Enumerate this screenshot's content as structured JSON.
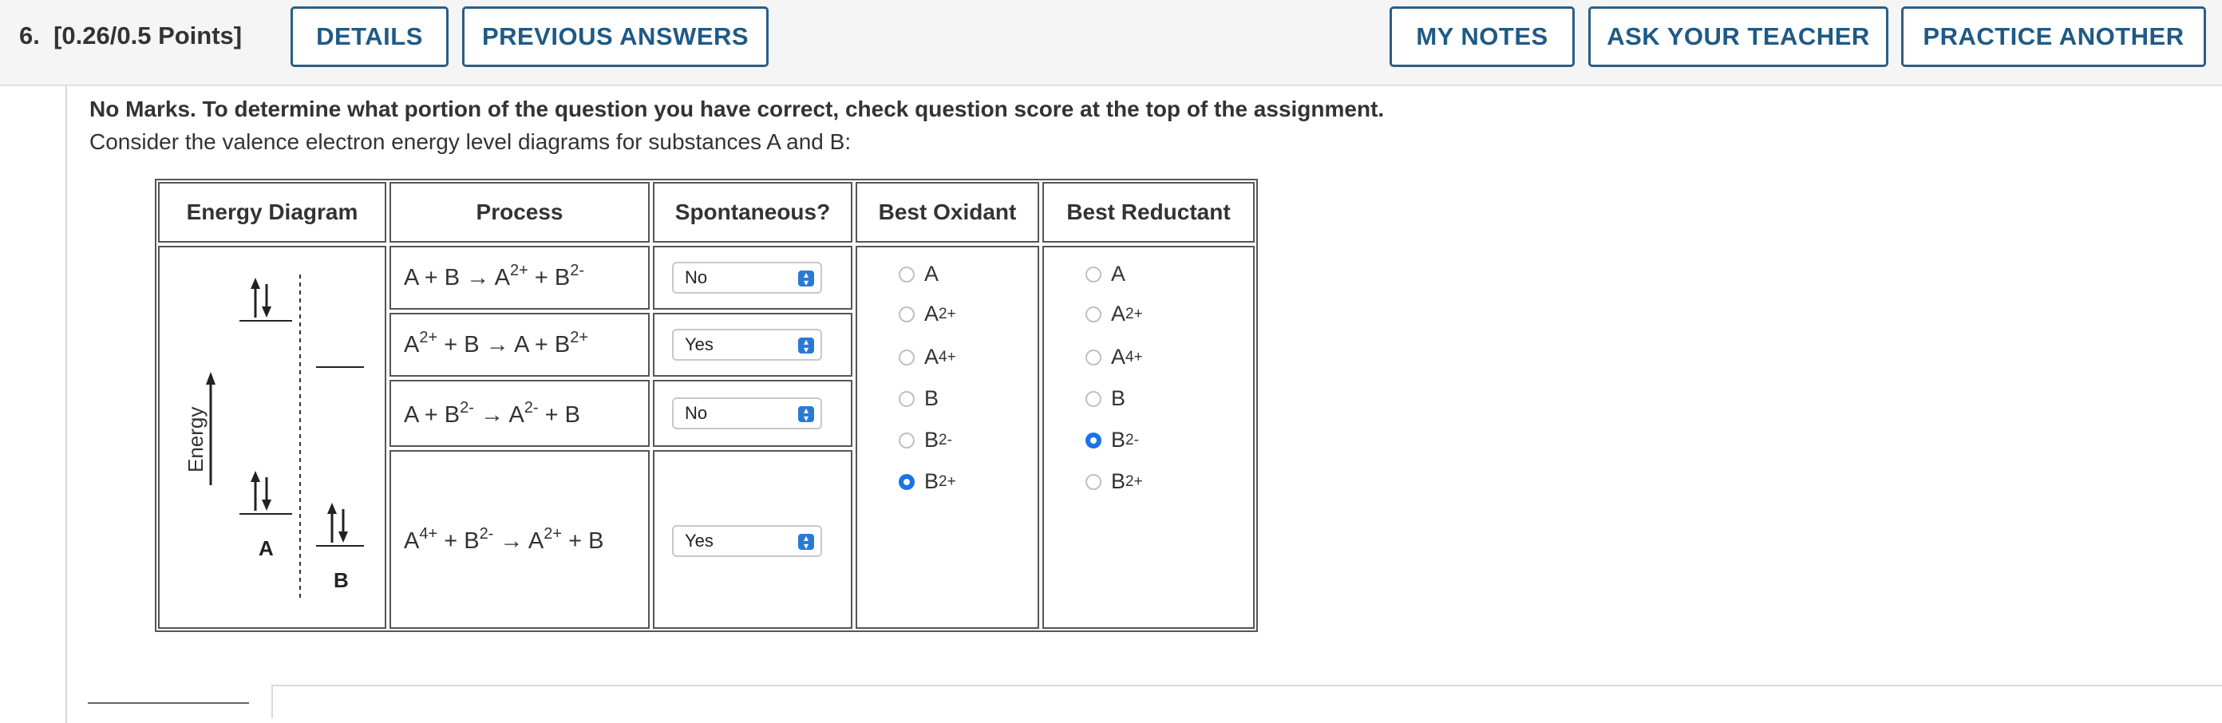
{
  "question": {
    "number": "6.",
    "points": "[0.26/0.5 Points]"
  },
  "buttons": {
    "details": "DETAILS",
    "previous_answers": "PREVIOUS ANSWERS",
    "my_notes": "MY NOTES",
    "ask_teacher": "ASK YOUR TEACHER",
    "practice_another": "PRACTICE ANOTHER"
  },
  "notice": "No Marks. To determine what portion of the question you have correct, check question score at the top of the assignment.",
  "intro": "Consider the valence electron energy level diagrams for substances A and B:",
  "table": {
    "headers": [
      "Energy Diagram",
      "Process",
      "Spontaneous?",
      "Best Oxidant",
      "Best Reductant"
    ],
    "processes": [
      {
        "pre": "A + B → A",
        "sup1": "2+",
        "mid": " + B",
        "sup2": "2-",
        "post": "",
        "selected": "No"
      },
      {
        "pre": "A",
        "sup1": "2+",
        "mid": " + B → A + B",
        "sup2": "2+",
        "post": "",
        "selected": "Yes"
      },
      {
        "pre": "A + B",
        "sup1": "2-",
        "mid": " → A",
        "sup2": "2-",
        "post": " + B",
        "selected": "No"
      },
      {
        "pre": "A",
        "sup1": "4+",
        "mid": " + B",
        "sup2": "2-",
        "post": " → A",
        "sup3": "2+",
        "post2": " + B",
        "selected": "Yes"
      }
    ],
    "oxidant_options": [
      {
        "base": "A",
        "sup": "",
        "checked": false
      },
      {
        "base": "A",
        "sup": "2+",
        "checked": false
      },
      {
        "base": "A",
        "sup": "4+",
        "checked": false
      },
      {
        "base": "B",
        "sup": "",
        "checked": false
      },
      {
        "base": "B",
        "sup": "2-",
        "checked": false
      },
      {
        "base": "B",
        "sup": "2+",
        "checked": true
      }
    ],
    "reductant_options": [
      {
        "base": "A",
        "sup": "",
        "checked": false
      },
      {
        "base": "A",
        "sup": "2+",
        "checked": false
      },
      {
        "base": "A",
        "sup": "4+",
        "checked": false
      },
      {
        "base": "B",
        "sup": "",
        "checked": false
      },
      {
        "base": "B",
        "sup": "2-",
        "checked": true
      },
      {
        "base": "B",
        "sup": "2+",
        "checked": false
      }
    ]
  },
  "diagram": {
    "axis_label": "Energy",
    "label_a": "A",
    "label_b": "B"
  },
  "colors": {
    "button_border": "#2a5d86",
    "button_text": "#1e5a86",
    "radio_checked": "#1a73e8",
    "select_arrow": "#2a7ad5"
  }
}
